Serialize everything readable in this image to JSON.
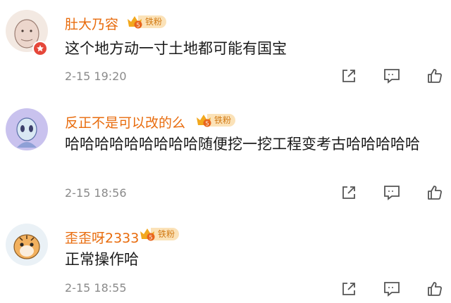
{
  "comments": [
    {
      "username": "肚大乃容",
      "badge": "铁粉",
      "text": "这个地方动一寸土地都可能有国宝",
      "time": "2-15 19:20"
    },
    {
      "username": "反正不是可以改的么",
      "badge": "铁粉",
      "text": "哈哈哈哈哈哈哈哈哈随便挖一挖工程变考古哈哈哈哈哈",
      "time": "2-15 18:56"
    },
    {
      "username": "歪歪呀2333",
      "badge": "铁粉",
      "text": "正常操作哈",
      "time": "2-15 18:55"
    }
  ],
  "icons": [
    "share-icon",
    "comment-icon",
    "like-icon",
    "level-badge-icon",
    "crown-icon"
  ],
  "colors": {
    "username": "#e86b0c",
    "text": "#1a1a1a",
    "time": "#8a8a8a",
    "badge_bg": "#fbe2b8",
    "action_icon": "#555555"
  }
}
